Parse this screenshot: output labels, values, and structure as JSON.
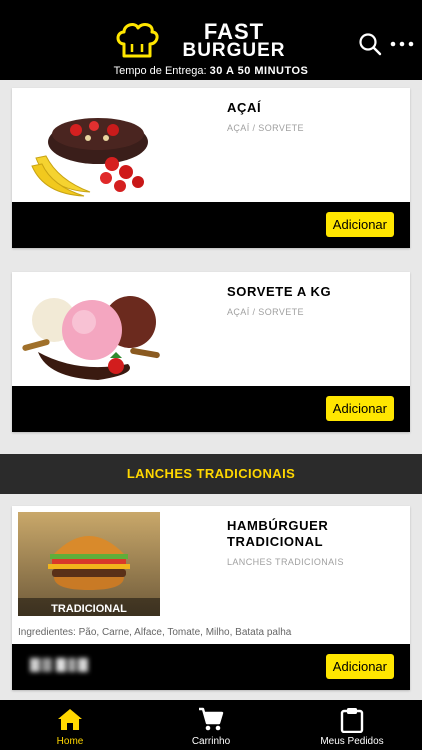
{
  "header": {
    "brand_line1": "FAST",
    "brand_line2": "BURGUER",
    "delivery_label": "Tempo de Entrega:",
    "delivery_value": "30 A 50 MINUTOS"
  },
  "colors": {
    "accent": "#ffe600",
    "section_text": "#ffd700",
    "bar": "#000000"
  },
  "products": [
    {
      "name": "AÇAÍ",
      "category": "AÇAÍ / SORVETE",
      "add_label": "Adicionar",
      "image": "acai-bowl-with-bananas-strawberries"
    },
    {
      "name": "SORVETE A KG",
      "category": "AÇAÍ / SORVETE",
      "add_label": "Adicionar",
      "image": "ice-cream-scoops"
    }
  ],
  "section_title": "LANCHES TRADICIONAIS",
  "burger": {
    "name": "HAMBÚRGUER TRADICIONAL",
    "category": "LANCHES TRADICIONAIS",
    "image_caption": "TRADICIONAL",
    "ingredients": "Ingredientes: Pão, Carne, Alface, Tomate, Milho, Batata palha",
    "add_label": "Adicionar"
  },
  "nav": [
    {
      "label": "Home",
      "icon": "home-icon",
      "active": true
    },
    {
      "label": "Carrinho",
      "icon": "cart-icon",
      "active": false
    },
    {
      "label": "Meus Pedidos",
      "icon": "clipboard-icon",
      "active": false
    }
  ]
}
